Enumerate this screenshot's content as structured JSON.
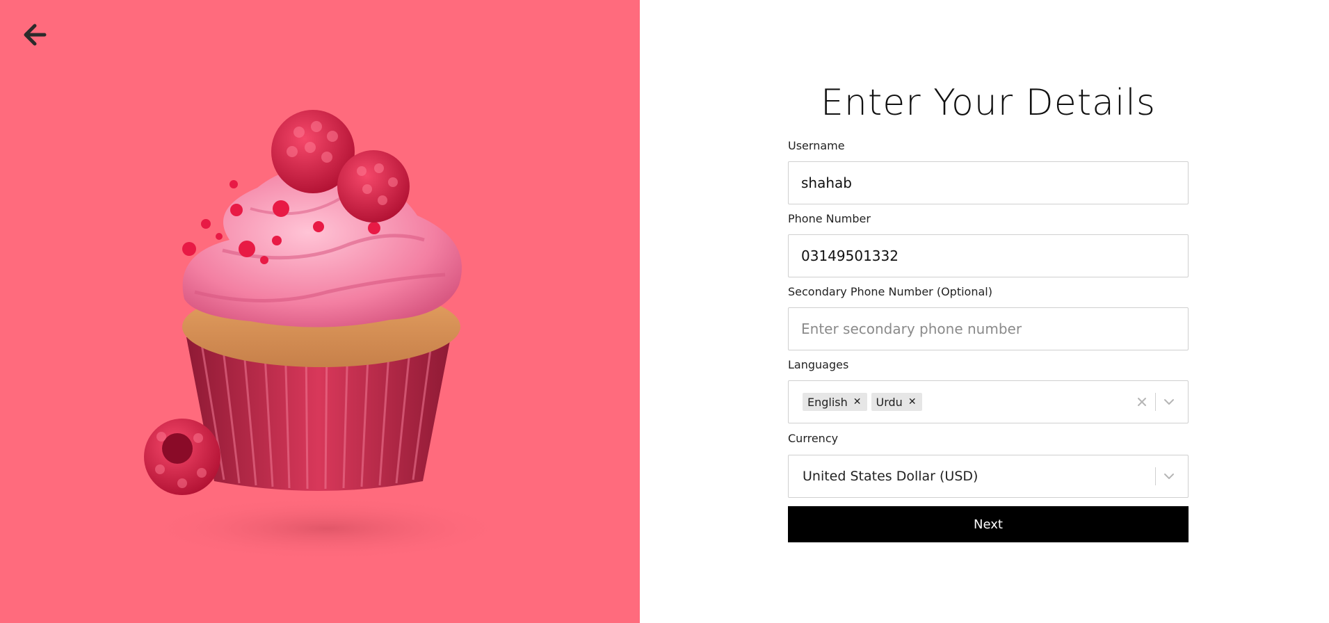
{
  "hero": {
    "background_color": "#ff6b7d",
    "back_icon": "arrow-left-icon",
    "illustration": "raspberry-cupcake"
  },
  "form": {
    "title": "Enter Your Details",
    "username": {
      "label": "Username",
      "value": "shahab"
    },
    "phone": {
      "label": "Phone Number",
      "value": "03149501332"
    },
    "secondary_phone": {
      "label": "Secondary Phone Number (Optional)",
      "value": "",
      "placeholder": "Enter secondary phone number"
    },
    "languages": {
      "label": "Languages",
      "selected": [
        "English",
        "Urdu"
      ],
      "clear_icon": "close-icon",
      "dropdown_icon": "chevron-down-icon"
    },
    "currency": {
      "label": "Currency",
      "selected": "United States Dollar (USD)",
      "dropdown_icon": "chevron-down-icon"
    },
    "next_label": "Next"
  },
  "colors": {
    "accent": "#ff6b7d",
    "button": "#000000",
    "border": "#cfcfcf",
    "chip": "#e6e6e6"
  }
}
